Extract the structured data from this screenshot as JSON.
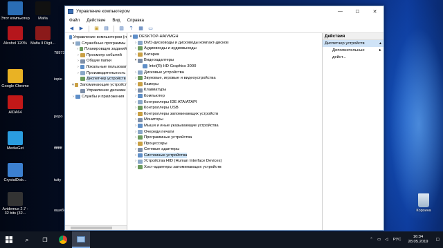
{
  "desktop": {
    "icons": [
      {
        "name": "desktop-icon-this-pc",
        "label": "Этот компьютер",
        "color": "#2a6db5"
      },
      {
        "name": "desktop-icon-mafia",
        "label": "Mafia",
        "color": "#111111"
      },
      {
        "name": "desktop-icon-alcohol",
        "label": "Alcohol 120%",
        "color": "#b5161c"
      },
      {
        "name": "desktop-icon-mafia2",
        "label": "Mafia II Digit...",
        "color": "#8b1a1a"
      },
      {
        "name": "desktop-icon-google-chrome",
        "label": "Google Chrome",
        "color": "#e9b224"
      },
      {
        "name": "desktop-icon-aida64",
        "label": "AIDA64",
        "color": "#c21818"
      },
      {
        "name": "desktop-icon-mediaget",
        "label": "MediaGet",
        "color": "#2a9de0"
      },
      {
        "name": "desktop-icon-crystaldisk",
        "label": "CrystalDisk...",
        "color": "#3c80d0"
      },
      {
        "name": "desktop-icon-avidemux",
        "label": "Avidemux 2.7 - 32 bits (32...",
        "color": "#333333"
      }
    ],
    "partial_labels": [
      "78973",
      "iopio",
      "popo",
      "ffffffff",
      "tuity",
      "ошибк"
    ],
    "recycle_bin_label": "Корзина"
  },
  "window": {
    "title": "Управление компьютером",
    "controls": {
      "minimize": "—",
      "maximize": "☐",
      "close": "✕"
    },
    "menu": [
      "Файл",
      "Действие",
      "Вид",
      "Справка"
    ]
  },
  "left_tree": [
    {
      "label": "Управление компьютером (л",
      "indent": 0,
      "twisty": ""
    },
    {
      "label": "Служебные программы",
      "indent": 1,
      "twisty": "▾"
    },
    {
      "label": "Планировщик заданий",
      "indent": 2,
      "twisty": "›"
    },
    {
      "label": "Просмотр событий",
      "indent": 2,
      "twisty": "›"
    },
    {
      "label": "Общие папки",
      "indent": 2,
      "twisty": "›"
    },
    {
      "label": "Локальные пользоват",
      "indent": 2,
      "twisty": "›"
    },
    {
      "label": "Производительность",
      "indent": 2,
      "twisty": "›"
    },
    {
      "label": "Диспетчер устройств",
      "indent": 2,
      "twisty": "",
      "selected": true
    },
    {
      "label": "Запоминающие устройст",
      "indent": 1,
      "twisty": "▾"
    },
    {
      "label": "Управление дисками",
      "indent": 2,
      "twisty": ""
    },
    {
      "label": "Службы и приложения",
      "indent": 1,
      "twisty": "›"
    }
  ],
  "device_tree": [
    {
      "label": "DESKTOP-HAIVMGH",
      "indent": 0,
      "twisty": "▾"
    },
    {
      "label": "DVD-дисководы и дисководы компакт-дисков",
      "indent": 1,
      "twisty": "›"
    },
    {
      "label": "Аудиовходы и аудиовыходы",
      "indent": 1,
      "twisty": "›"
    },
    {
      "label": "Батареи",
      "indent": 1,
      "twisty": "›"
    },
    {
      "label": "Видеоадаптеры",
      "indent": 1,
      "twisty": "▾"
    },
    {
      "label": "Intel(R) HD Graphics 3000",
      "indent": 2,
      "twisty": ""
    },
    {
      "label": "Дисковые устройства",
      "indent": 1,
      "twisty": "›"
    },
    {
      "label": "Звуковые, игровые и видеоустройства",
      "indent": 1,
      "twisty": "›"
    },
    {
      "label": "Камеры",
      "indent": 1,
      "twisty": "›"
    },
    {
      "label": "Клавиатуры",
      "indent": 1,
      "twisty": "›"
    },
    {
      "label": "Компьютер",
      "indent": 1,
      "twisty": "›"
    },
    {
      "label": "Контроллеры IDE ATA/ATAPI",
      "indent": 1,
      "twisty": "›"
    },
    {
      "label": "Контроллеры USB",
      "indent": 1,
      "twisty": "›"
    },
    {
      "label": "Контроллеры запоминающих устройств",
      "indent": 1,
      "twisty": "›"
    },
    {
      "label": "Мониторы",
      "indent": 1,
      "twisty": "›"
    },
    {
      "label": "Мыши и иные указывающие устройства",
      "indent": 1,
      "twisty": "›"
    },
    {
      "label": "Очереди печати",
      "indent": 1,
      "twisty": "›"
    },
    {
      "label": "Программные устройства",
      "indent": 1,
      "twisty": "›"
    },
    {
      "label": "Процессоры",
      "indent": 1,
      "twisty": "›"
    },
    {
      "label": "Сетевые адаптеры",
      "indent": 1,
      "twisty": "›"
    },
    {
      "label": "Системные устройства",
      "indent": 1,
      "twisty": "›",
      "highlighted": true
    },
    {
      "label": "Устройства HID (Human Interface Devices)",
      "indent": 1,
      "twisty": "›"
    },
    {
      "label": "Хост-адаптеры запоминающих устройств",
      "indent": 1,
      "twisty": "›"
    }
  ],
  "actions": {
    "header": "Действия",
    "selected": "Диспетчер устройств",
    "more": "Дополнительные дейст..."
  },
  "taskbar": {
    "language": "РУС",
    "time": "16:34",
    "date": "28.05.2019"
  }
}
